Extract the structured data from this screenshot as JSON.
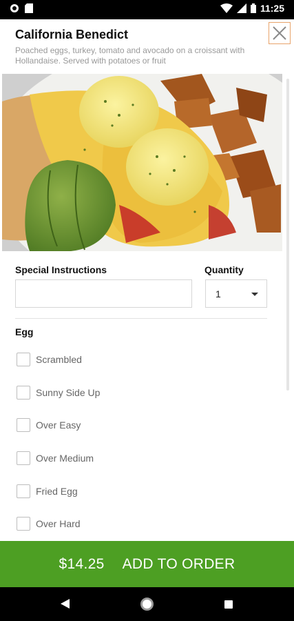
{
  "status_bar": {
    "time": "11:25"
  },
  "item": {
    "title": "California Benedict",
    "description": "Poached eggs, turkey, tomato and avocado on a croissant with Hollandaise. Served with potatoes or fruit"
  },
  "form": {
    "special_instructions_label": "Special Instructions",
    "special_instructions_value": "",
    "quantity_label": "Quantity",
    "quantity_value": "1"
  },
  "egg_group": {
    "label": "Egg",
    "options": [
      {
        "label": "Scrambled"
      },
      {
        "label": "Sunny Side Up"
      },
      {
        "label": "Over Easy"
      },
      {
        "label": "Over Medium"
      },
      {
        "label": "Fried Egg"
      },
      {
        "label": "Over Hard"
      }
    ]
  },
  "order": {
    "price": "$14.25",
    "label": "ADD TO ORDER"
  },
  "colors": {
    "accent_green": "#4d9f23",
    "close_border": "#e8a36a"
  },
  "icons": [
    "close-icon",
    "wifi-icon",
    "signal-icon",
    "battery-icon",
    "back-icon",
    "home-icon",
    "recents-icon"
  ]
}
